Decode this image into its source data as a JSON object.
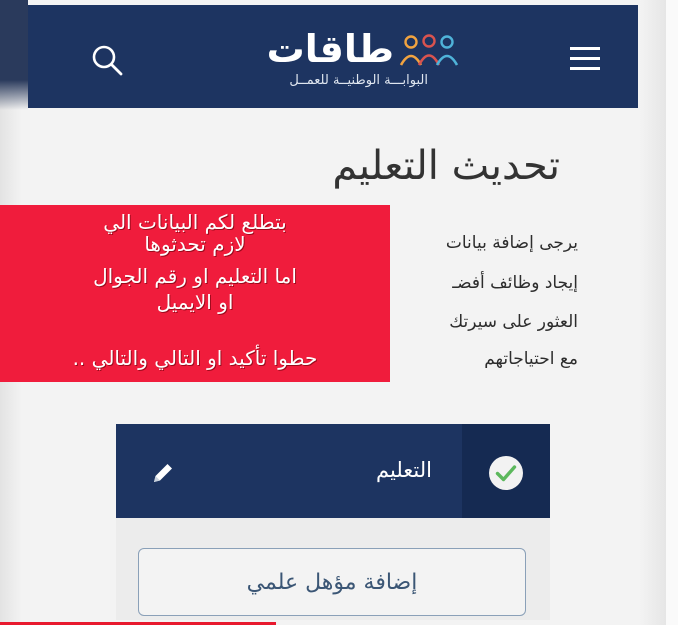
{
  "header": {
    "brand_name": "طاقات",
    "brand_tagline": "البوابـــة الوطنيــة للعمــل",
    "search_icon": "search-icon",
    "menu_icon": "hamburger-menu-icon",
    "logo_icon": "people-logo-icon",
    "background_color": "#1d3461"
  },
  "page": {
    "title": "تحديث التعليم",
    "paragraph_lines": [
      "يرجى إضافة بيانات",
      "إيجاد وظائف أفضـ",
      "العثور على سيرتك",
      "مع احتياجاتهم"
    ]
  },
  "overlay": {
    "lines": [
      "بتطلع لكم البيانات الي",
      "لازم تحدثوها",
      "اما التعليم او رقم الجوال",
      "او الايميل",
      "حطوا تأكيد او التالي والتالي .."
    ],
    "background_color": "#f01c3c"
  },
  "education_panel": {
    "label": "التعليم",
    "status_icon": "check-circle-icon",
    "edit_icon": "pencil-icon",
    "add_button_label": "إضافة مؤهل علمي"
  }
}
